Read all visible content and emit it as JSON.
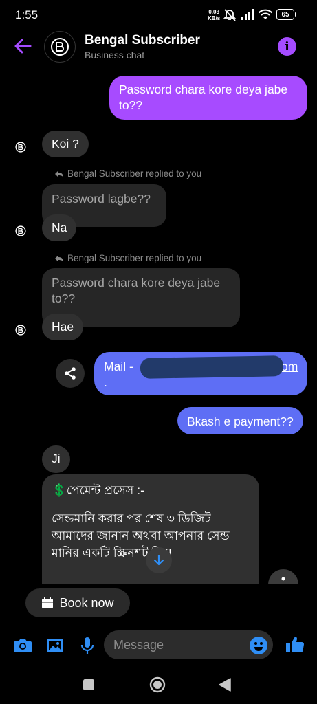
{
  "status": {
    "time": "1:55",
    "speed_value": "0.03",
    "speed_unit": "KB/s",
    "battery": "65"
  },
  "header": {
    "title": "Bengal Subscriber",
    "subtitle": "Business chat",
    "avatar_logo_text": "BS",
    "accent": "#a54cff"
  },
  "messages": {
    "m1_out": "Password chara kore deya jabe to??",
    "m2_in": "Koi ?",
    "reply1_label": "Bengal Subscriber replied to you",
    "reply1_quote": "Password lagbe??",
    "reply1_text": "Na",
    "reply2_label": "Bengal Subscriber replied to you",
    "reply2_quote": "Password chara kore deya jabe to??",
    "reply2_text": "Hae",
    "mail_prefix": "Mail - ",
    "mail_suffix": "om",
    "mail_tail": ".",
    "m_bkash": "Bkash e payment??",
    "m_ji": "Ji",
    "card_emoji": "💲",
    "card_title": "পেমেন্ট প্রসেস :-",
    "card_body": "সেন্ডমানি করার পর শেষ ৩ ডিজিট আমাদের জানান অথবা আপনার সেন্ড মানির একটি স্ক্রিনশট দিন!"
  },
  "actions": {
    "book_now": "Book now"
  },
  "composer": {
    "placeholder": "Message"
  },
  "colors": {
    "outgoing_purple": "#a74bff",
    "outgoing_blue": "#5e6ef5",
    "incoming": "#303030",
    "icon_blue": "#2f8ef5"
  }
}
